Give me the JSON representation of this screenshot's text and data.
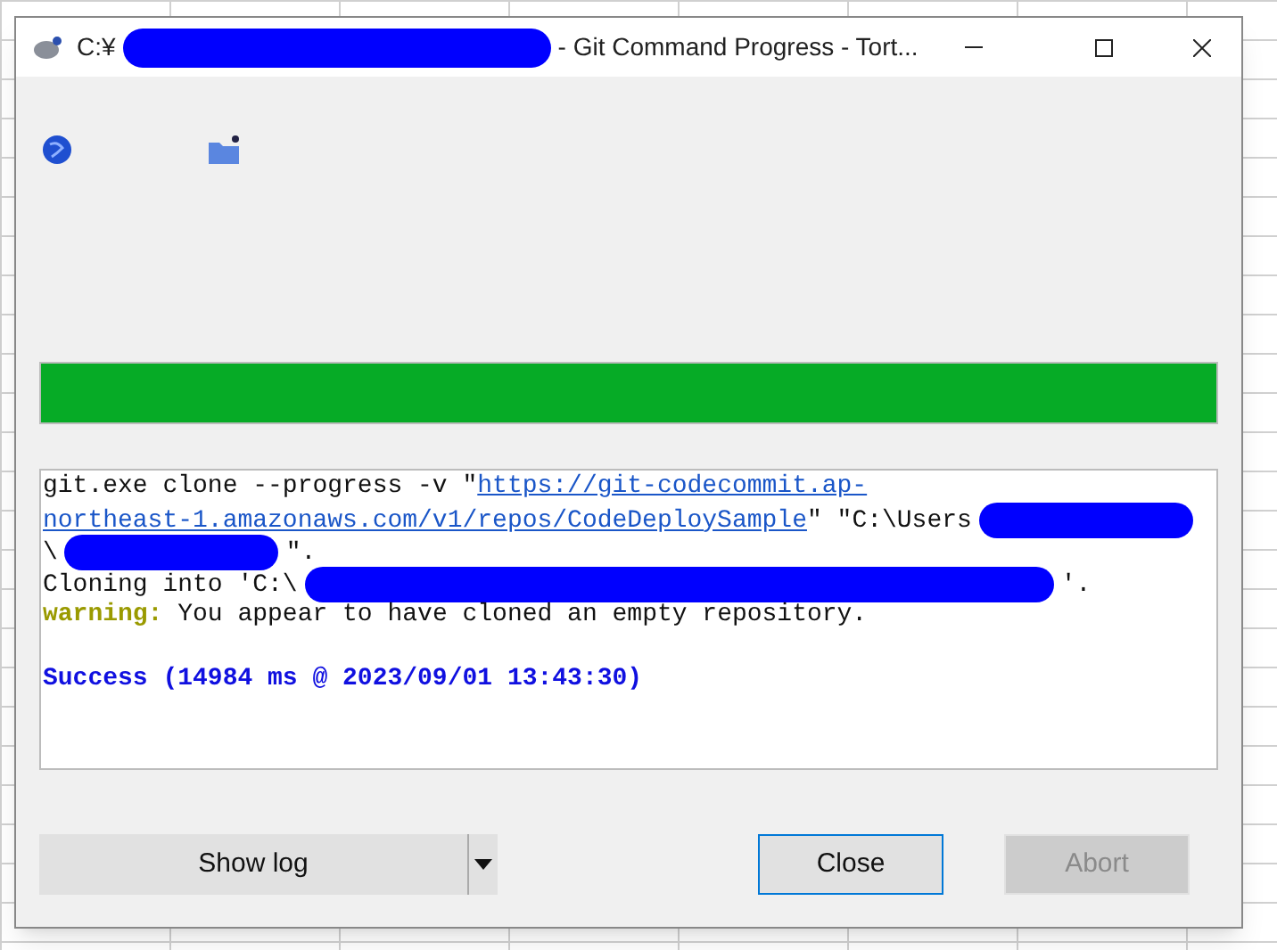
{
  "window": {
    "title": [
      {
        "kind": "text",
        "text": "C:¥"
      },
      {
        "kind": "redacted"
      },
      {
        "kind": "text",
        "text": "- Git Command Progress - Tort..."
      }
    ]
  },
  "progress": {
    "level": 1
  },
  "log": [
    {
      "segments": [
        {
          "kind": "text",
          "text": "git.exe clone --progress -v \""
        },
        {
          "kind": "link",
          "text": "https://git-codecommit.ap-"
        }
      ]
    },
    {
      "segments": [
        {
          "kind": "link",
          "text": "northeast-1.amazonaws.com/v1/repos/CodeDeploySample"
        },
        {
          "kind": "text",
          "text": "\" \"C:\\Users"
        },
        {
          "kind": "redacted",
          "wide": false
        }
      ]
    },
    {
      "segments": [
        {
          "kind": "text",
          "text": "\\"
        },
        {
          "kind": "redacted",
          "wide": false
        },
        {
          "kind": "text",
          "text": "\"."
        }
      ]
    },
    {
      "segments": [
        {
          "kind": "text",
          "text": "Cloning into 'C:\\"
        },
        {
          "kind": "redacted",
          "wide": true
        },
        {
          "kind": "text",
          "text": "'."
        }
      ]
    },
    {
      "segments": [
        {
          "kind": "warning",
          "text": "warning:"
        },
        {
          "kind": "text",
          "text": " You appear to have cloned an empty repository."
        }
      ]
    },
    {
      "kind": "blank"
    },
    {
      "segments": [
        {
          "kind": "success",
          "text": "Success (14984 ms @ 2023/09/01 13:43:30)"
        }
      ]
    }
  ],
  "buttons": [
    {
      "label": "Show log",
      "kind": "split",
      "disabled": false,
      "focused": false
    },
    {
      "label": "Close",
      "kind": "plain",
      "disabled": false,
      "focused": true
    },
    {
      "label": "Abort",
      "kind": "plain",
      "disabled": true,
      "focused": false
    }
  ]
}
